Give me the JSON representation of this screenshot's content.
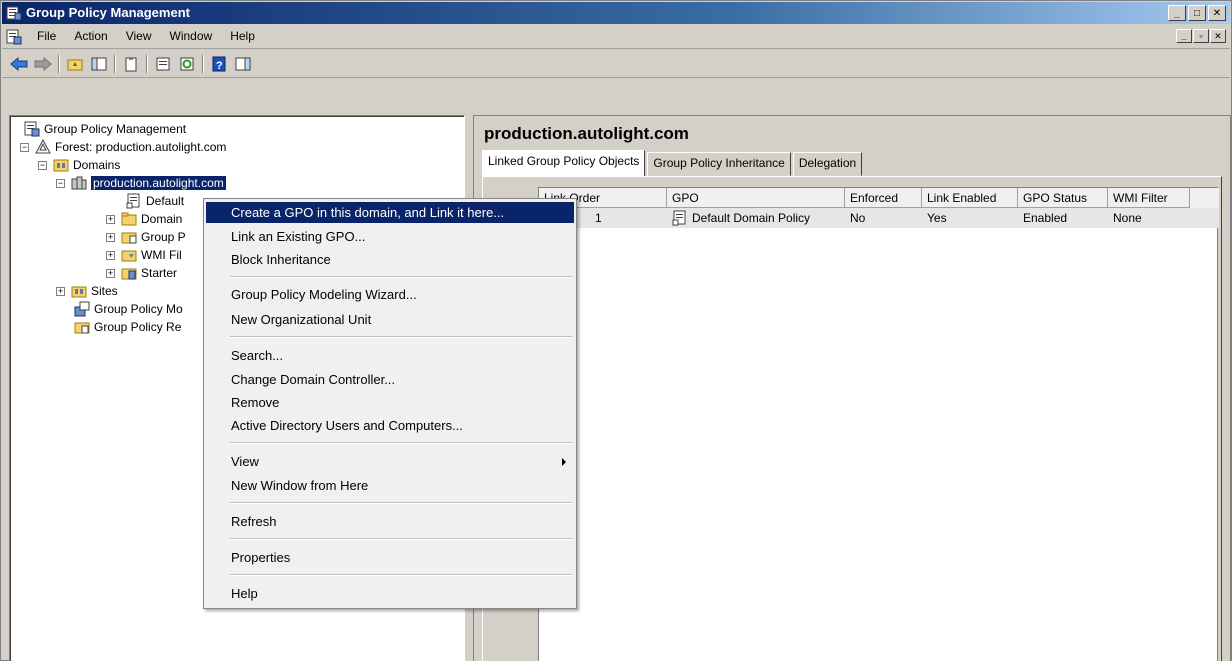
{
  "window": {
    "title": "Group Policy Management",
    "controls": [
      "minimize",
      "maximize",
      "close"
    ]
  },
  "menubar": {
    "items": [
      "File",
      "Action",
      "View",
      "Window",
      "Help"
    ]
  },
  "toolbar": {
    "buttons": [
      "back-icon",
      "forward-icon",
      "up-folder-icon",
      "show-hide-console-tree-icon",
      "clipboard-icon",
      "properties-icon",
      "refresh-icon",
      "help-icon",
      "action-pane-icon"
    ]
  },
  "tree": {
    "root": "Group Policy Management",
    "forest": "Forest: production.autolight.com",
    "domains": "Domains",
    "domain": "production.autolight.com",
    "children": [
      "Default",
      "Domain",
      "Group P",
      "WMI Fil",
      "Starter"
    ],
    "sites": "Sites",
    "modeling": "Group Policy Mo",
    "results": "Group Policy Re"
  },
  "right": {
    "header": "production.autolight.com",
    "tabs": [
      "Linked Group Policy Objects",
      "Group Policy Inheritance",
      "Delegation"
    ],
    "columns": [
      "Link Order",
      "GPO",
      "Enforced",
      "Link Enabled",
      "GPO Status",
      "WMI Filter"
    ],
    "rows": [
      {
        "order": "1",
        "gpo": "Default Domain Policy",
        "enforced": "No",
        "link_enabled": "Yes",
        "status": "Enabled",
        "wmi": "None"
      }
    ]
  },
  "context_menu": {
    "items": [
      "Create a GPO in this domain, and Link it here...",
      "Link an Existing GPO...",
      "Block Inheritance",
      "Group Policy Modeling Wizard...",
      "New Organizational Unit",
      "Search...",
      "Change Domain Controller...",
      "Remove",
      "Active Directory Users and Computers...",
      "View",
      "New Window from Here",
      "Refresh",
      "Properties",
      "Help"
    ]
  },
  "colors": {
    "selection": "#0a246a",
    "face": "#d4d0c8"
  }
}
